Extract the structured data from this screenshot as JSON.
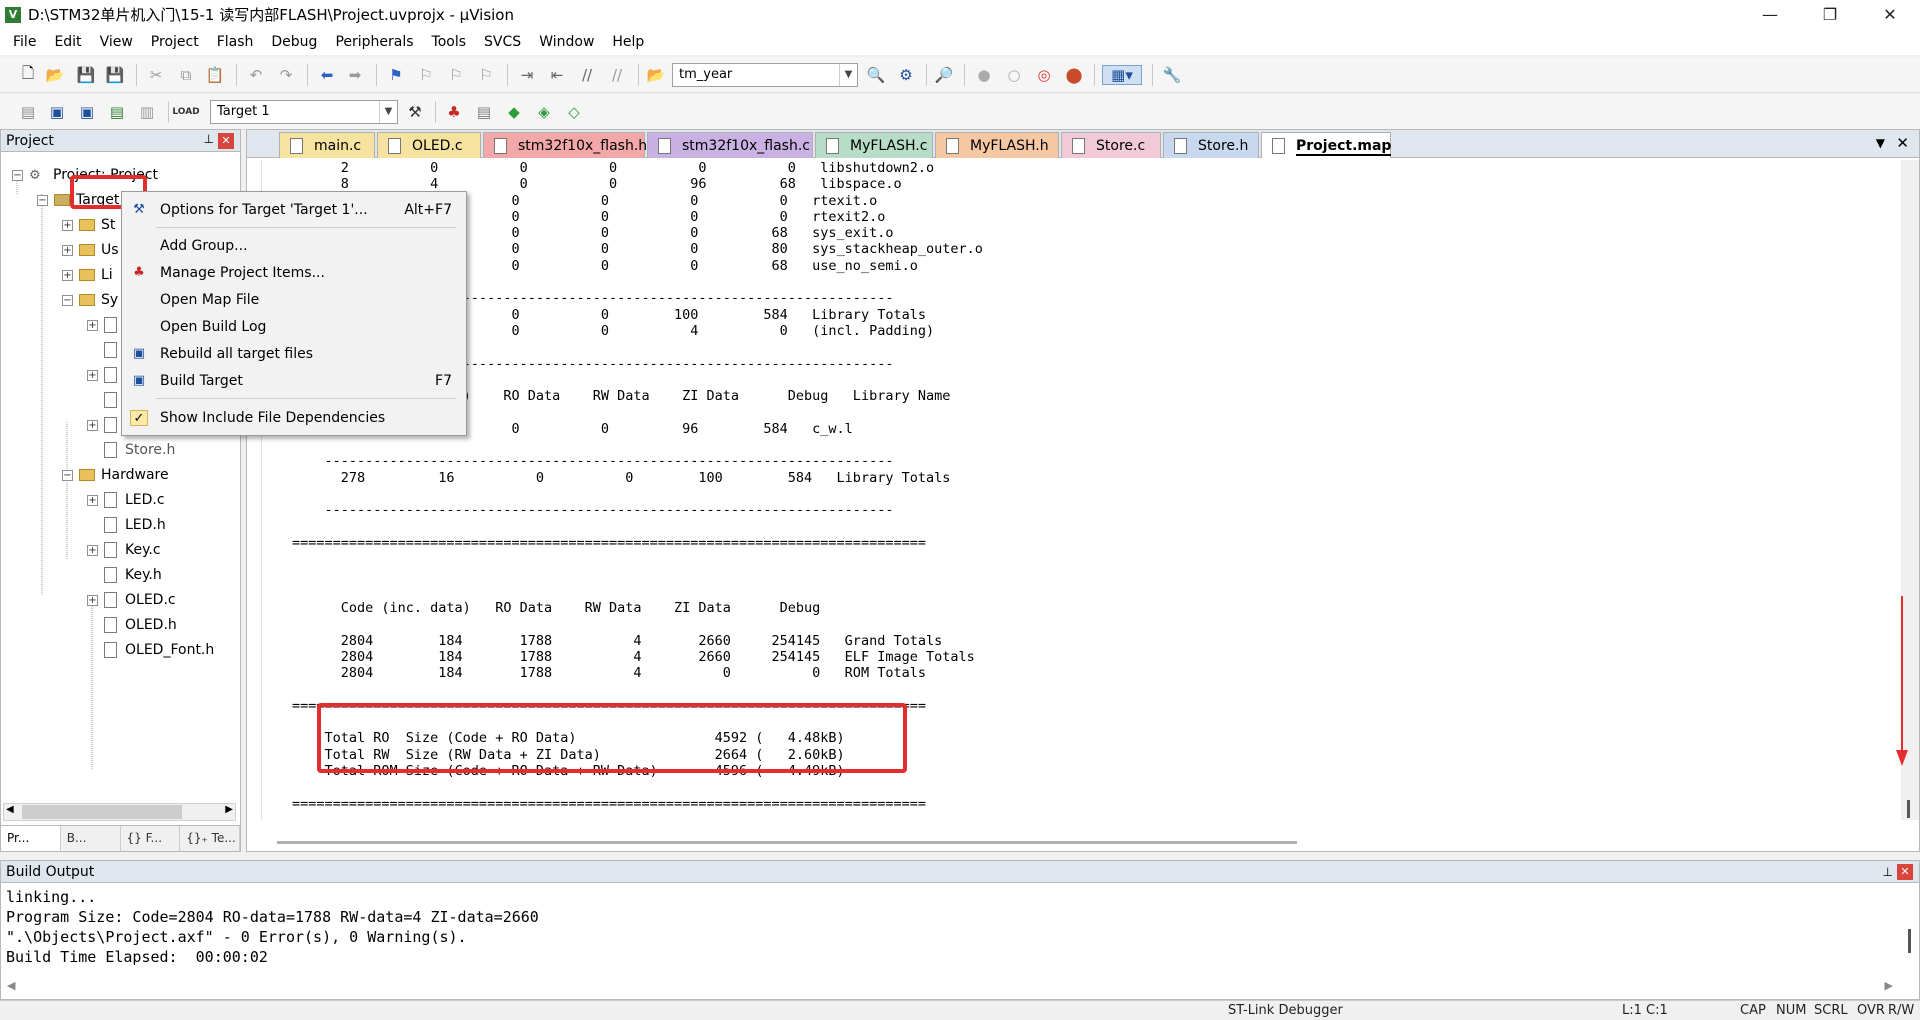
{
  "window": {
    "title": "D:\\STM32单片机入门\\15-1 读写内部FLASH\\Project.uvprojx - µVision",
    "icon_label": "V",
    "minimize": "—",
    "maximize": "❐",
    "close": "✕"
  },
  "menu": [
    "File",
    "Edit",
    "View",
    "Project",
    "Flash",
    "Debug",
    "Peripherals",
    "Tools",
    "SVCS",
    "Window",
    "Help"
  ],
  "toolbar": {
    "find_combo_value": "tm_year",
    "target_combo_value": "Target 1"
  },
  "project_panel": {
    "title": "Project",
    "pin": "📌",
    "close": "✕",
    "root": "Project: Project",
    "target": "Target 1",
    "groups": [
      "St",
      "Us",
      "Li",
      "Sy"
    ],
    "store_partial": "Store.h",
    "hardware_group": "Hardware",
    "hardware_files": [
      "LED.c",
      "LED.h",
      "Key.c",
      "Key.h",
      "OLED.c",
      "OLED.h",
      "OLED_Font.h"
    ],
    "bottom_tabs": [
      "Pr...",
      "B...",
      "{} F...",
      "{}₊ Te..."
    ]
  },
  "context_menu": {
    "items": [
      {
        "label": "Options for Target 'Target 1'...",
        "shortcut": "Alt+F7"
      },
      {
        "label": "Add Group...",
        "shortcut": ""
      },
      {
        "label": "Manage Project Items...",
        "shortcut": ""
      },
      {
        "label": "Open Map File",
        "shortcut": ""
      },
      {
        "label": "Open Build Log",
        "shortcut": ""
      },
      {
        "label": "Rebuild all target files",
        "shortcut": ""
      },
      {
        "label": "Build Target",
        "shortcut": "F7"
      },
      {
        "label": "Show Include File Dependencies",
        "shortcut": ""
      }
    ],
    "check_mark": "✓"
  },
  "editor_tabs": [
    {
      "label": "main.c",
      "color": "#f6e3a0"
    },
    {
      "label": "OLED.c",
      "color": "#f6e3a0"
    },
    {
      "label": "stm32f10x_flash.h",
      "color": "#f2a8a8"
    },
    {
      "label": "stm32f10x_flash.c",
      "color": "#c9b2e3"
    },
    {
      "label": "MyFLASH.c",
      "color": "#b7dcc8"
    },
    {
      "label": "MyFLASH.h",
      "color": "#f6c7a3"
    },
    {
      "label": "Store.c",
      "color": "#f2c9d6"
    },
    {
      "label": "Store.h",
      "color": "#c8d8ee"
    },
    {
      "label": "Project.map",
      "color": "#ffffff"
    }
  ],
  "map_lines": [
    "      2          0          0          0          0          0   libshutdown2.o",
    "      8          4          0          0         96         68   libspace.o",
    "                0          0          0          0          0   rtexit.o",
    "                0          0          0          0          0   rtexit2.o",
    "                0          0          0          0         68   sys_exit.o",
    "                0          0          0          0         80   sys_stackheap_outer.o",
    "                0          0          0          0         68   use_no_semi.o",
    "",
    "    ----------------------------------------------------------------------",
    "                0          0          0        100        584   Library Totals",
    "                0          0          0          4          0   (incl. Padding)",
    "",
    "    ----------------------------------------------------------------------",
    "",
    "                    a)    RO Data    RW Data    ZI Data      Debug   Library Name",
    "",
    "                           0          0         96        584   c_w.l",
    "",
    "    ----------------------------------------------------------------------",
    "      278         16          0          0        100        584   Library Totals",
    "",
    "    ----------------------------------------------------------------------",
    "",
    "==============================================================================",
    "",
    "",
    "",
    "      Code (inc. data)   RO Data    RW Data    ZI Data      Debug",
    "",
    "      2804        184       1788          4       2660     254145   Grand Totals",
    "      2804        184       1788          4       2660     254145   ELF Image Totals",
    "      2804        184       1788          4          0          0   ROM Totals",
    "",
    "==============================================================================",
    "",
    "    Total RO  Size (Code + RO Data)                 4592 (   4.48kB)",
    "    Total RW  Size (RW Data + ZI Data)              2664 (   2.60kB)",
    "    Total ROM Size (Code + RO Data + RW Data)       4596 (   4.49kB)",
    "",
    "=============================================================================="
  ],
  "build_output": {
    "title": "Build Output",
    "lines": [
      "linking...",
      "Program Size: Code=2804 RO-data=1788 RW-data=4 ZI-data=2660",
      "\".\\Objects\\Project.axf\" - 0 Error(s), 0 Warning(s).",
      "Build Time Elapsed:  00:00:02"
    ]
  },
  "status": {
    "debugger": "ST-Link Debugger",
    "position": "L:1 C:1",
    "cap": "CAP",
    "num": "NUM",
    "scrl": "SCRL",
    "ovr": "OVR",
    "rw": "R/W"
  },
  "colors": {
    "highlight_red": "#e52d2d",
    "panel_header": "#dfe6ee"
  }
}
